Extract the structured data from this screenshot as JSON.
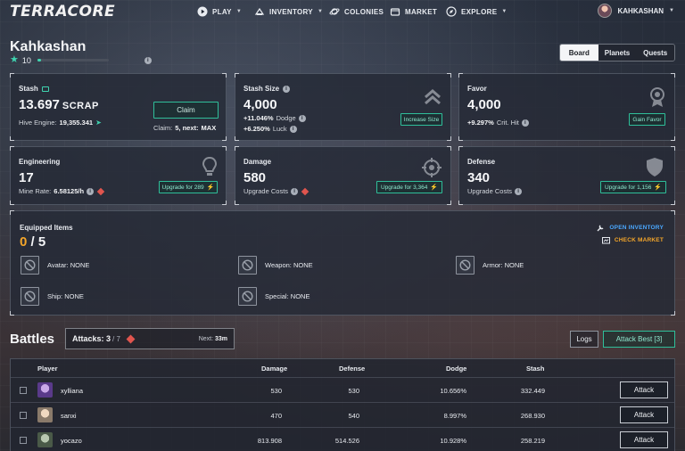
{
  "nav": {
    "logo": "TERRACORE",
    "items": [
      {
        "label": "PLAY",
        "icon": "play-icon",
        "caret": true
      },
      {
        "label": "INVENTORY",
        "icon": "backpack-icon",
        "caret": true
      },
      {
        "label": "COLONIES",
        "icon": "planet-icon",
        "caret": false
      },
      {
        "label": "MARKET",
        "icon": "market-icon",
        "caret": false
      },
      {
        "label": "EXPLORE",
        "icon": "compass-icon",
        "caret": true
      }
    ],
    "user": "KAHKASHAN"
  },
  "profile": {
    "name": "Kahkashan",
    "level": "10",
    "xp_fraction": 0.05
  },
  "view_tabs": [
    {
      "label": "Board",
      "active": true
    },
    {
      "label": "Planets",
      "active": false
    },
    {
      "label": "Quests",
      "active": false
    }
  ],
  "stats": {
    "stash": {
      "title": "Stash",
      "value": "13.697",
      "unit": "SCRAP",
      "hive_label": "Hive Engine:",
      "hive_value": "19,355.341",
      "claim_button": "Claim",
      "claim_label": "Claim:",
      "claim_value": "5, next:",
      "claim_next": "MAX"
    },
    "stash_size": {
      "title": "Stash Size",
      "value": "4,000",
      "line1_value": "+11.046%",
      "line1_label": "Dodge",
      "line2_value": "+6.250%",
      "line2_label": "Luck",
      "button": "Increase Size"
    },
    "favor": {
      "title": "Favor",
      "value": "4,000",
      "line1_value": "+9.297%",
      "line1_label": "Crit. Hit",
      "button": "Gain Favor"
    },
    "engineering": {
      "title": "Engineering",
      "value": "17",
      "sub_label": "Mine Rate:",
      "sub_value": "6.58125/h",
      "button": "Upgrade for 289"
    },
    "damage": {
      "title": "Damage",
      "value": "580",
      "sub_label": "Upgrade Costs",
      "button": "Upgrade for 3,364"
    },
    "defense": {
      "title": "Defense",
      "value": "340",
      "sub_label": "Upgrade Costs",
      "button": "Upgrade for 1,156"
    }
  },
  "equipped": {
    "title": "Equipped Items",
    "current": "0",
    "separator": "/",
    "max": "5",
    "open_inventory": "OPEN INVENTORY",
    "check_market": "CHECK MARKET",
    "slots": [
      {
        "label": "Avatar:",
        "value": "NONE"
      },
      {
        "label": "Weapon:",
        "value": "NONE"
      },
      {
        "label": "Armor:",
        "value": "NONE"
      },
      {
        "label": "Ship:",
        "value": "NONE"
      },
      {
        "label": "Special:",
        "value": "NONE"
      }
    ]
  },
  "battles": {
    "title": "Battles",
    "attacks_label": "Attacks:",
    "attacks_current": "3",
    "attacks_max": "/ 7",
    "next_label": "Next:",
    "next_value": "33m",
    "logs_button": "Logs",
    "attack_best_button": "Attack Best [3]",
    "columns": [
      "Player",
      "Damage",
      "Defense",
      "Dodge",
      "Stash"
    ],
    "rows": [
      {
        "player": "xylliana",
        "damage": "530",
        "defense": "530",
        "dodge": "10.656%",
        "stash": "332.449",
        "action": "Attack"
      },
      {
        "player": "sanxi",
        "damage": "470",
        "defense": "540",
        "dodge": "8.997%",
        "stash": "268.930",
        "action": "Attack"
      },
      {
        "player": "yocazo",
        "damage": "813.908",
        "defense": "514.526",
        "dodge": "10.928%",
        "stash": "258.219",
        "action": "Attack"
      }
    ]
  },
  "colors": {
    "accent_teal": "#2fbf9a",
    "accent_orange": "#f4a62a",
    "warning_red": "#e0554e"
  }
}
